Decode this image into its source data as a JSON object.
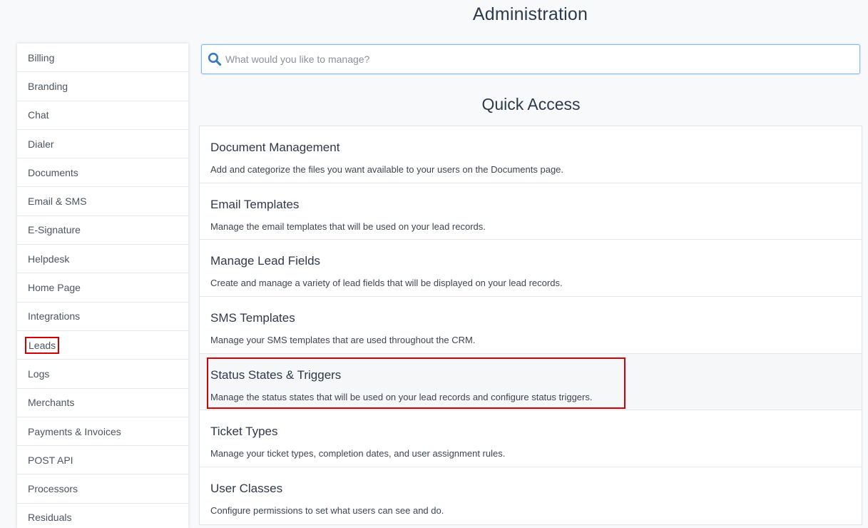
{
  "header": {
    "title": "Administration"
  },
  "search": {
    "placeholder": "What would you like to manage?",
    "value": ""
  },
  "sidebar": {
    "items": [
      {
        "label": "Billing"
      },
      {
        "label": "Branding"
      },
      {
        "label": "Chat"
      },
      {
        "label": "Dialer"
      },
      {
        "label": "Documents"
      },
      {
        "label": "Email & SMS"
      },
      {
        "label": "E-Signature"
      },
      {
        "label": "Helpdesk"
      },
      {
        "label": "Home Page"
      },
      {
        "label": "Integrations"
      },
      {
        "label": "Leads",
        "highlighted": true
      },
      {
        "label": "Logs"
      },
      {
        "label": "Merchants"
      },
      {
        "label": "Payments & Invoices"
      },
      {
        "label": "POST API"
      },
      {
        "label": "Processors"
      },
      {
        "label": "Residuals"
      }
    ]
  },
  "quick_access": {
    "title": "Quick Access",
    "items": [
      {
        "title": "Document Management",
        "description": "Add and categorize the files you want available to your users on the Documents page."
      },
      {
        "title": "Email Templates",
        "description": "Manage the email templates that will be used on your lead records."
      },
      {
        "title": "Manage Lead Fields",
        "description": "Create and manage a variety of lead fields that will be displayed on your lead records."
      },
      {
        "title": "SMS Templates",
        "description": "Manage your SMS templates that are used throughout the CRM."
      },
      {
        "title": "Status States & Triggers",
        "description": "Manage the status states that will be used on your lead records and configure status triggers.",
        "highlighted": true
      },
      {
        "title": "Ticket Types",
        "description": "Manage your ticket types, completion dates, and user assignment rules."
      },
      {
        "title": "User Classes",
        "description": "Configure permissions to set what users can see and do."
      }
    ]
  },
  "colors": {
    "highlight": "#d00000",
    "search_icon": "#3a7bbf",
    "search_border": "#80bdff"
  },
  "icons": {
    "search": "search-icon"
  }
}
